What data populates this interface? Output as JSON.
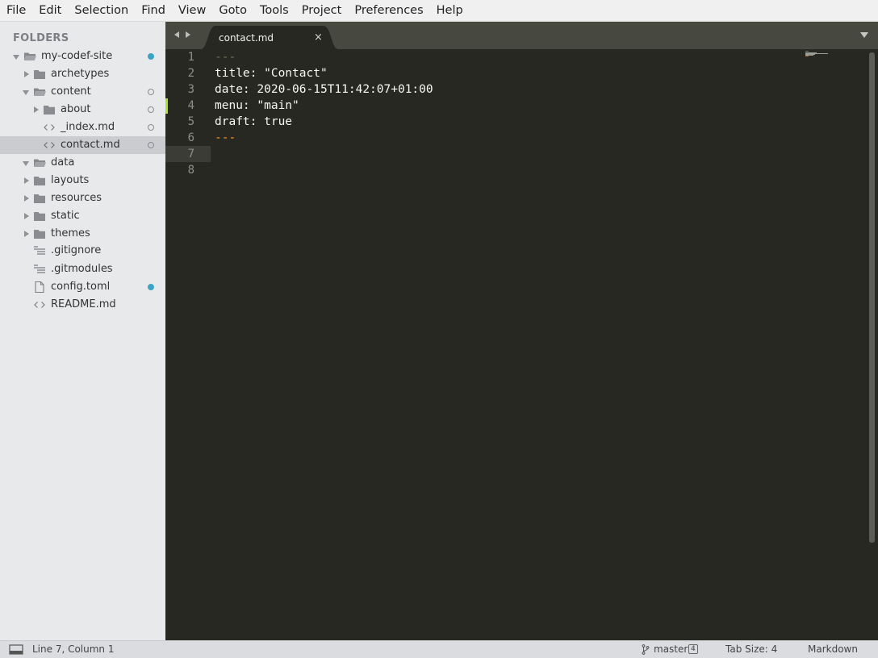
{
  "menubar": {
    "items": [
      "File",
      "Edit",
      "Selection",
      "Find",
      "View",
      "Goto",
      "Tools",
      "Project",
      "Preferences",
      "Help"
    ]
  },
  "sidebar": {
    "title": "FOLDERS",
    "tree": [
      {
        "label": "my-codef-site",
        "type": "folder-open",
        "icon": "folder-open-icon",
        "status": "modified"
      },
      {
        "label": "archetypes",
        "type": "folder",
        "icon": "folder-icon"
      },
      {
        "label": "content",
        "type": "folder-open",
        "icon": "folder-open-icon",
        "status": "untracked"
      },
      {
        "label": "about",
        "type": "folder",
        "icon": "folder-icon",
        "status": "untracked"
      },
      {
        "label": "_index.md",
        "type": "file",
        "icon": "code-file-icon",
        "status": "untracked"
      },
      {
        "label": "contact.md",
        "type": "file",
        "icon": "code-file-icon",
        "status": "untracked",
        "selected": true
      },
      {
        "label": "data",
        "type": "folder-open",
        "icon": "folder-open-icon"
      },
      {
        "label": "layouts",
        "type": "folder",
        "icon": "folder-icon"
      },
      {
        "label": "resources",
        "type": "folder",
        "icon": "folder-icon"
      },
      {
        "label": "static",
        "type": "folder",
        "icon": "folder-icon"
      },
      {
        "label": "themes",
        "type": "folder",
        "icon": "folder-icon"
      },
      {
        "label": ".gitignore",
        "type": "file",
        "icon": "text-lines-icon"
      },
      {
        "label": ".gitmodules",
        "type": "file",
        "icon": "text-lines-icon"
      },
      {
        "label": "config.toml",
        "type": "file",
        "icon": "blank-file-icon",
        "status": "modified"
      },
      {
        "label": "README.md",
        "type": "file",
        "icon": "code-file-icon"
      }
    ]
  },
  "tabs": [
    {
      "label": "contact.md",
      "active": true,
      "close": "×"
    }
  ],
  "editor": {
    "line_numbers": [
      "1",
      "2",
      "3",
      "4",
      "5",
      "6",
      "7",
      "8"
    ],
    "lines": [
      "---",
      "title: \"Contact\"",
      "date: 2020-06-15T11:42:07+01:00",
      "menu: \"main\"",
      "draft: true",
      "---",
      "",
      ""
    ],
    "current_line": 7,
    "modified_line": 4
  },
  "statusbar": {
    "position": "Line 7, Column 1",
    "branch": "master",
    "branch_count": "4",
    "tab_size": "Tab Size: 4",
    "syntax": "Markdown"
  },
  "colors": {
    "editor_bg": "#272822",
    "sidebar_bg": "#e8e9eb",
    "modified_dot": "#3ba4c4",
    "yaml_delimiter_dim": "#75715e",
    "yaml_delimiter_active": "#fd971f",
    "gutter_modified": "#a6e22e"
  }
}
